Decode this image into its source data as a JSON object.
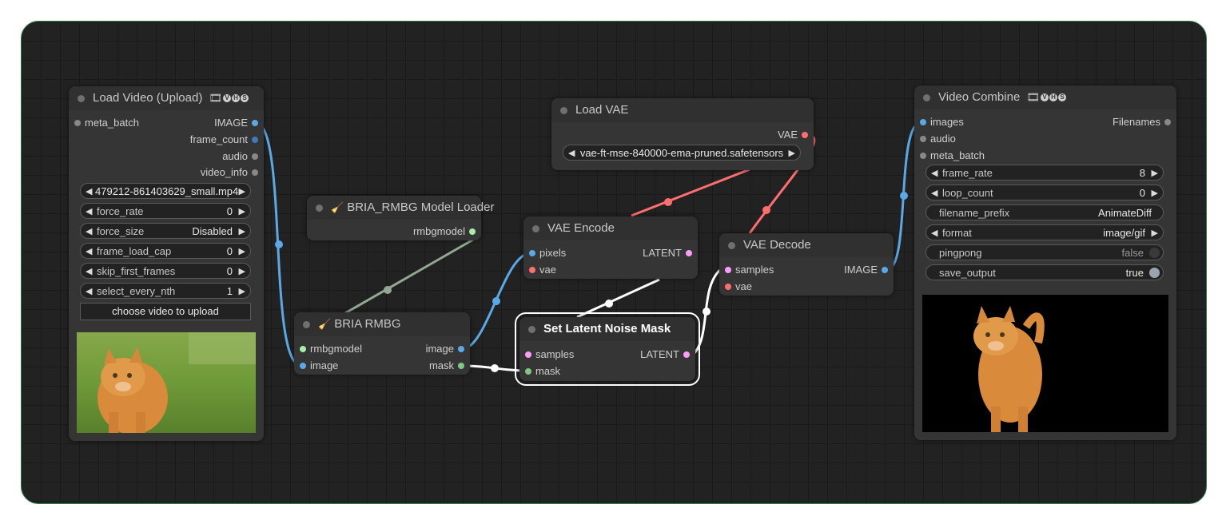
{
  "colors": {
    "image": "#5aa9e6",
    "latent": "#ff9cf9",
    "vae": "#ff6e6e",
    "mask": "#81c784",
    "meta": "#888888",
    "model": "#a5d6a7",
    "audio": "#888888"
  },
  "load_video": {
    "title": "Load Video (Upload)",
    "badges": [
      "V",
      "H",
      "S"
    ],
    "inputs": [
      {
        "label": "meta_batch"
      }
    ],
    "outputs": [
      {
        "label": "IMAGE"
      },
      {
        "label": "frame_count"
      },
      {
        "label": "audio"
      },
      {
        "label": "video_info"
      }
    ],
    "widgets": {
      "video": "479212-861403629_small.mp4",
      "force_rate": {
        "label": "force_rate",
        "value": "0"
      },
      "force_size": {
        "label": "force_size",
        "value": "Disabled"
      },
      "frame_load_cap": {
        "label": "frame_load_cap",
        "value": "0"
      },
      "skip_first_frames": {
        "label": "skip_first_frames",
        "value": "0"
      },
      "select_every_nth": {
        "label": "select_every_nth",
        "value": "1"
      },
      "upload_button": "choose video to upload"
    }
  },
  "model_loader": {
    "title": "BRIA_RMBG Model Loader",
    "outputs": [
      {
        "label": "rmbgmodel"
      }
    ]
  },
  "bria_rmbg": {
    "title": "BRIA RMBG",
    "inputs": [
      {
        "label": "rmbgmodel"
      },
      {
        "label": "image"
      }
    ],
    "outputs": [
      {
        "label": "image"
      },
      {
        "label": "mask"
      }
    ]
  },
  "load_vae": {
    "title": "Load VAE",
    "outputs": [
      {
        "label": "VAE"
      }
    ],
    "vae_name": "vae-ft-mse-840000-ema-pruned.safetensors"
  },
  "vae_encode": {
    "title": "VAE Encode",
    "inputs": [
      {
        "label": "pixels"
      },
      {
        "label": "vae"
      }
    ],
    "outputs": [
      {
        "label": "LATENT"
      }
    ]
  },
  "set_latent_mask": {
    "title": "Set Latent Noise Mask",
    "inputs": [
      {
        "label": "samples"
      },
      {
        "label": "mask"
      }
    ],
    "outputs": [
      {
        "label": "LATENT"
      }
    ]
  },
  "vae_decode": {
    "title": "VAE Decode",
    "inputs": [
      {
        "label": "samples"
      },
      {
        "label": "vae"
      }
    ],
    "outputs": [
      {
        "label": "IMAGE"
      }
    ]
  },
  "video_combine": {
    "title": "Video Combine",
    "badges": [
      "V",
      "H",
      "S"
    ],
    "inputs": [
      {
        "label": "images"
      },
      {
        "label": "audio"
      },
      {
        "label": "meta_batch"
      }
    ],
    "outputs": [
      {
        "label": "Filenames"
      }
    ],
    "widgets": {
      "frame_rate": {
        "label": "frame_rate",
        "value": "8"
      },
      "loop_count": {
        "label": "loop_count",
        "value": "0"
      },
      "filename_prefix": {
        "label": "filename_prefix",
        "value": "AnimateDiff"
      },
      "format": {
        "label": "format",
        "value": "image/gif"
      },
      "pingpong": {
        "label": "pingpong",
        "value": "false"
      },
      "save_output": {
        "label": "save_output",
        "value": "true"
      }
    }
  }
}
